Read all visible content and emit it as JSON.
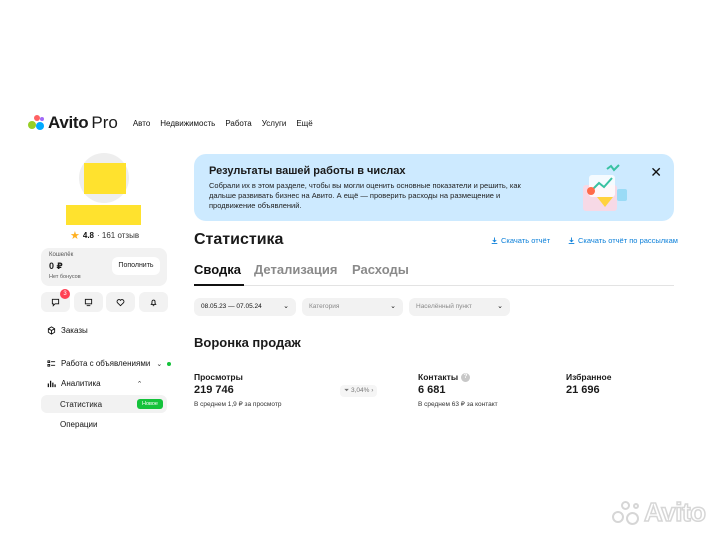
{
  "header": {
    "logo_text": "Avito",
    "logo_suffix": "Pro",
    "nav": [
      "Авто",
      "Недвижимость",
      "Работа",
      "Услуги",
      "Ещё"
    ]
  },
  "profile": {
    "rating_value": "4.8",
    "reviews": "· 161 отзыв"
  },
  "wallet": {
    "label": "Кошелёк",
    "amount": "0 ₽",
    "bonus": "Нет бонусов",
    "topup_label": "Пополнить"
  },
  "icon_buttons": {
    "messages_badge": "3"
  },
  "sidebar": {
    "orders": "Заказы",
    "listings": "Работа с объявлениями",
    "analytics": "Аналитика",
    "statistics": "Статистика",
    "statistics_badge": "Новое",
    "operations": "Операции"
  },
  "banner": {
    "title": "Результаты вашей работы в числах",
    "text": "Собрали их в этом разделе, чтобы вы могли оценить основные показатели и решить, как дальше развивать бизнес на Авито. А ещё — проверить расходы на размещение и продвижение объявлений."
  },
  "page": {
    "title": "Статистика",
    "download_report": "Скачать отчёт",
    "download_by_mail": "Скачать отчёт по рассылкам"
  },
  "tabs": [
    "Сводка",
    "Детализация",
    "Расходы"
  ],
  "filters": {
    "date_range": "08.05.23 — 07.05.24",
    "category_placeholder": "Категория",
    "location_placeholder": "Населённый пункт"
  },
  "funnel": {
    "title": "Воронка продаж",
    "views_label": "Просмотры",
    "views_value": "219 746",
    "views_sub": "В среднем 1,9 ₽ за просмотр",
    "conversion": "3,04%",
    "contacts_label": "Контакты",
    "contacts_value": "6 681",
    "contacts_sub": "В среднем 63 ₽ за контакт",
    "favorites_label": "Избранное",
    "favorites_value": "21 696"
  },
  "watermark": {
    "text": "Avito"
  },
  "colors": {
    "brand_yellow": "#ffe22e",
    "banner_bg": "#cdeaff",
    "link_blue": "#0a7fd9",
    "new_green": "#14c23b",
    "badge_red": "#ff4053"
  }
}
